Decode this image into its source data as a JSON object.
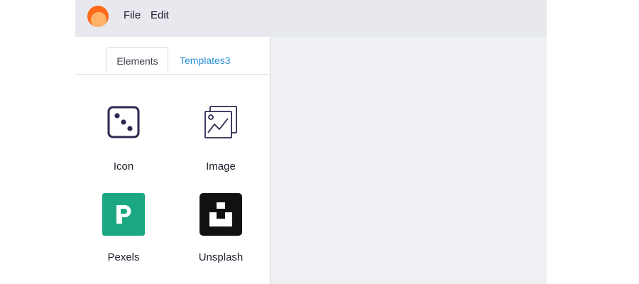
{
  "menu": {
    "file_label": "File",
    "edit_label": "Edit"
  },
  "tabs": [
    {
      "label": "Elements",
      "active": true
    },
    {
      "label": "Templates3",
      "active": false
    }
  ],
  "elements": [
    {
      "label": "Icon",
      "icon": "dice-icon"
    },
    {
      "label": "Image",
      "icon": "image-icon"
    },
    {
      "label": "Pexels",
      "icon": "pexels-logo-icon",
      "color": "#1aa782"
    },
    {
      "label": "Unsplash",
      "icon": "unsplash-logo-icon",
      "color": "#111111"
    }
  ],
  "colors": {
    "accent_link": "#2a8fd6",
    "topbar_bg": "#e8e9ee",
    "canvas_bg": "#eef0f4",
    "logo_orange": "#ff6a1a"
  }
}
